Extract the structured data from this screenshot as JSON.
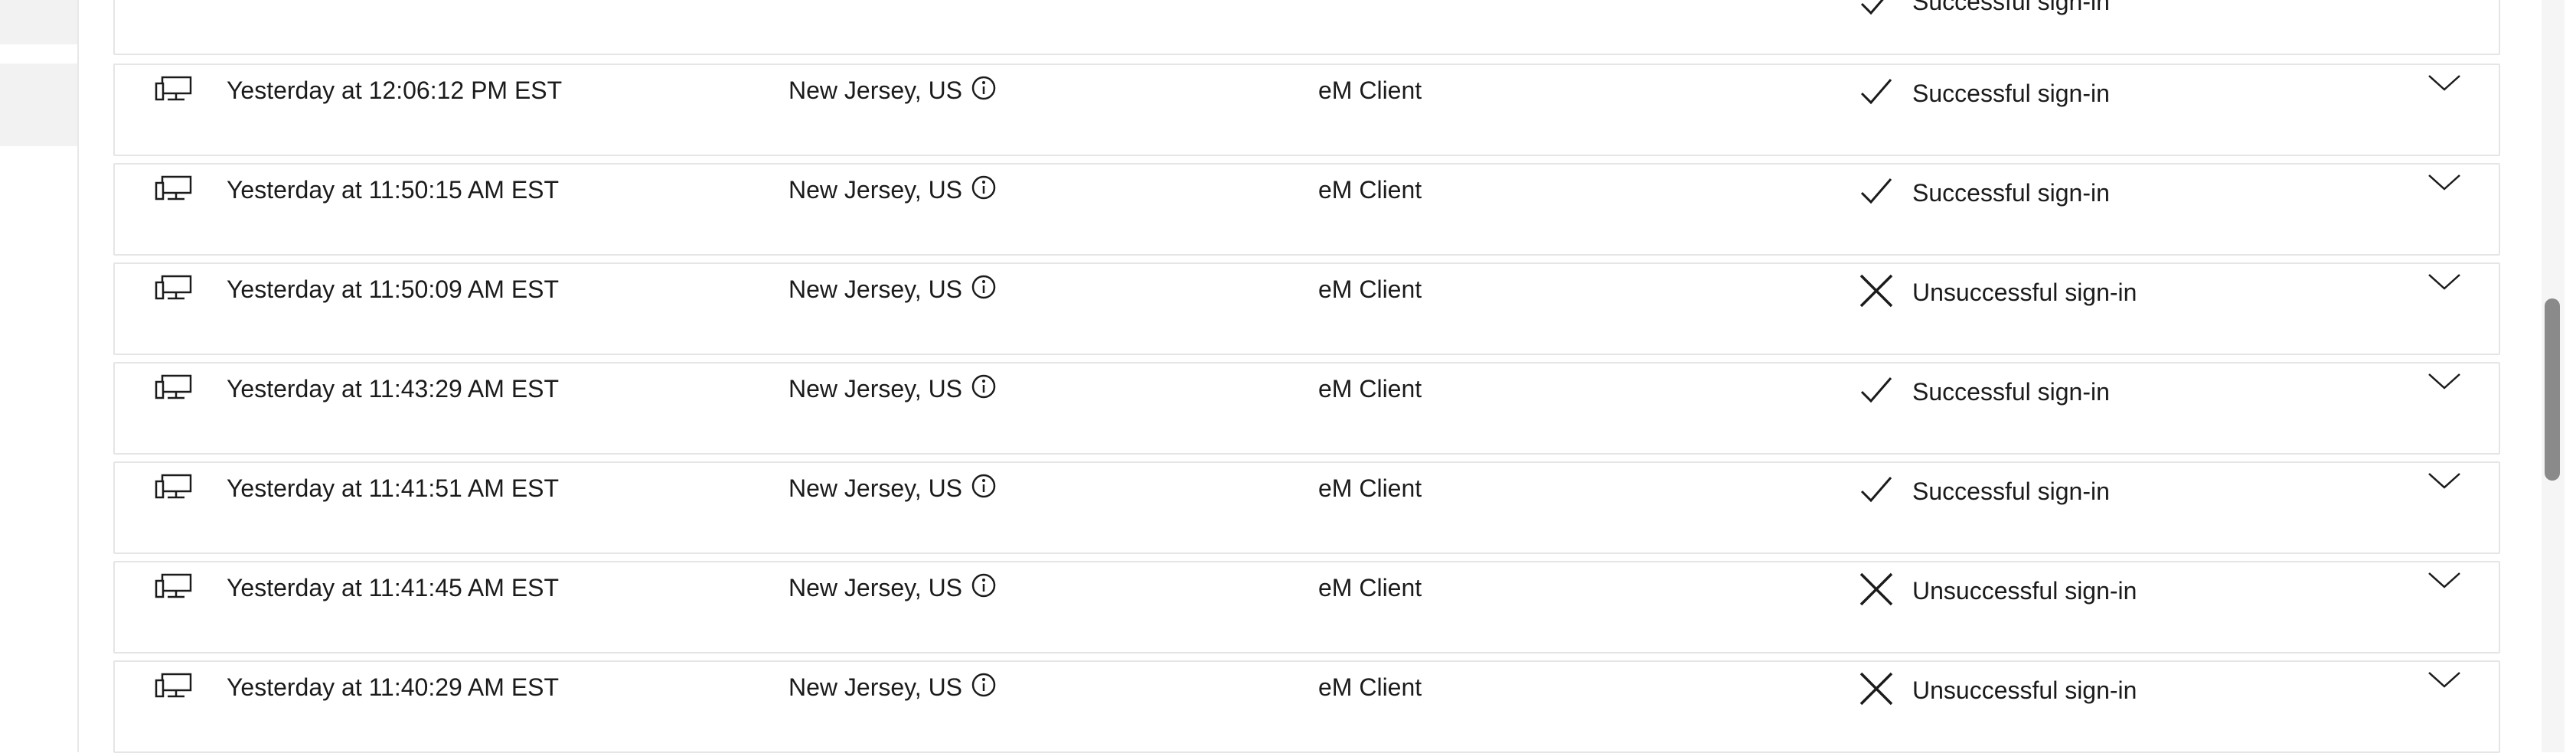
{
  "activities": [
    {
      "time": "",
      "location": "",
      "app": "",
      "status": "Successful sign-in",
      "result": "success"
    },
    {
      "time": "Yesterday at 12:06:12 PM EST",
      "location": "New Jersey, US",
      "app": "eM Client",
      "status": "Successful sign-in",
      "result": "success"
    },
    {
      "time": "Yesterday at 11:50:15 AM EST",
      "location": "New Jersey, US",
      "app": "eM Client",
      "status": "Successful sign-in",
      "result": "success"
    },
    {
      "time": "Yesterday at 11:50:09 AM EST",
      "location": "New Jersey, US",
      "app": "eM Client",
      "status": "Unsuccessful sign-in",
      "result": "failure"
    },
    {
      "time": "Yesterday at 11:43:29 AM EST",
      "location": "New Jersey, US",
      "app": "eM Client",
      "status": "Successful sign-in",
      "result": "success"
    },
    {
      "time": "Yesterday at 11:41:51 AM EST",
      "location": "New Jersey, US",
      "app": "eM Client",
      "status": "Successful sign-in",
      "result": "success"
    },
    {
      "time": "Yesterday at 11:41:45 AM EST",
      "location": "New Jersey, US",
      "app": "eM Client",
      "status": "Unsuccessful sign-in",
      "result": "failure"
    },
    {
      "time": "Yesterday at 11:40:29 AM EST",
      "location": "New Jersey, US",
      "app": "eM Client",
      "status": "Unsuccessful sign-in",
      "result": "failure"
    }
  ],
  "icons": {
    "device": "desktop-computer-icon",
    "info": "info-icon",
    "success": "checkmark-icon",
    "failure": "x-mark-icon",
    "expand": "chevron-down-icon"
  },
  "colors": {
    "row_border": "#e5e5e5",
    "sidebar_selected": "#f2f2f2",
    "scrollbar_thumb": "#8a8a8a",
    "text": "#1b1b1b"
  }
}
